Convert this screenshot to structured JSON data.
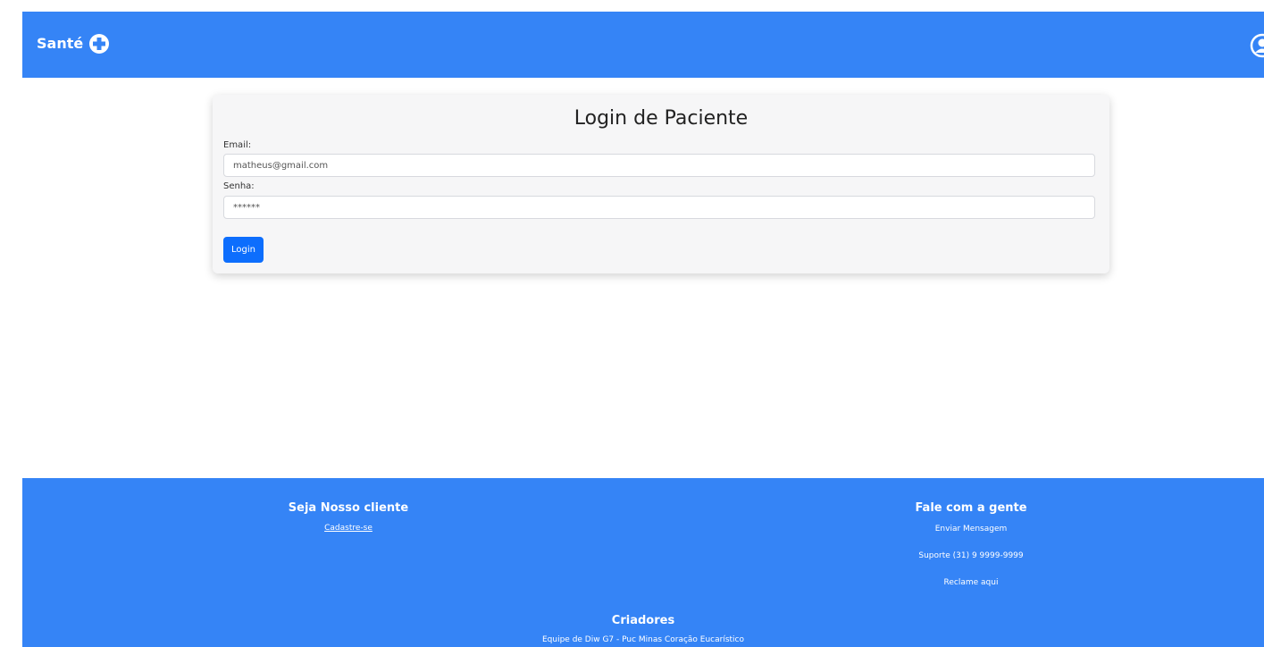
{
  "header": {
    "brand": "Santé",
    "brand_icon": "plus-circle-icon",
    "user_icon": "user-circle-icon",
    "color": "#3584f6"
  },
  "login_card": {
    "title": "Login de Paciente",
    "email_label": "Email:",
    "email_value": "matheus@gmail.com",
    "password_label": "Senha:",
    "password_value": "******",
    "login_button": "Login",
    "button_color": "#0d6efd"
  },
  "footer": {
    "left": {
      "heading": "Seja Nosso cliente",
      "link": "Cadastre-se"
    },
    "right": {
      "heading": "Fale com a gente",
      "send_message": "Enviar Mensagem",
      "support": "Suporte (31) 9 9999-9999",
      "complain": "Reclame aqui"
    },
    "center": {
      "heading": "Criadores",
      "team": "Equipe de Diw G7 - Puc Minas Coração Eucarístico"
    }
  }
}
